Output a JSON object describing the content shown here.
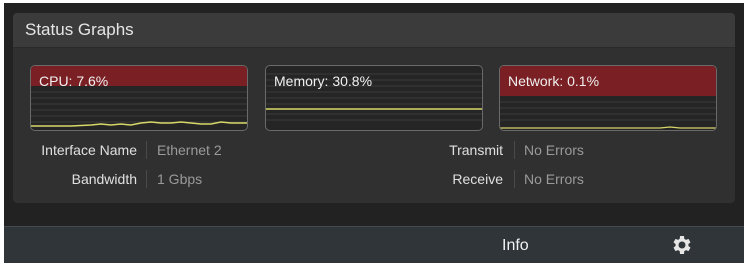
{
  "panel": {
    "title": "Status Graphs"
  },
  "graphs": [
    {
      "label": "CPU: 7.6%",
      "value_percent": 7.6
    },
    {
      "label": "Memory: 30.8%",
      "value_percent": 30.8
    },
    {
      "label": "Network: 0.1%",
      "value_percent": 0.1
    }
  ],
  "details": {
    "interface_name_label": "Interface Name",
    "interface_name_value": "Ethernet 2",
    "bandwidth_label": "Bandwidth",
    "bandwidth_value": "1 Gbps",
    "transmit_label": "Transmit",
    "transmit_value": "No Errors",
    "receive_label": "Receive",
    "receive_value": "No Errors"
  },
  "footer": {
    "label": "Info",
    "settings_icon": "gear-icon"
  },
  "colors": {
    "graph_alert_band": "#7a1f23",
    "graph_line": "#d8d86a",
    "background": "#222222"
  }
}
